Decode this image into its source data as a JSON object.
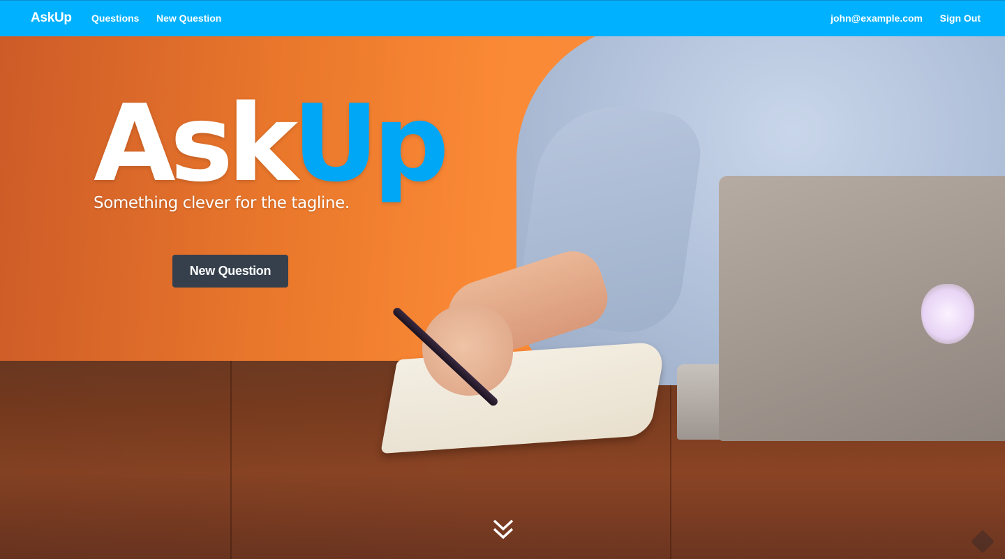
{
  "navbar": {
    "brand": "AskUp",
    "links": {
      "questions": "Questions",
      "new_question": "New Question"
    },
    "user_email": "john@example.com",
    "sign_out": "Sign Out",
    "background_color": "#00b1ff"
  },
  "hero": {
    "title_main": "Ask",
    "title_accent": "Up",
    "accent_color": "#00a7f7",
    "tagline": "Something clever for the tagline.",
    "cta_label": "New Question",
    "cta_color": "#36404d",
    "scroll_icon": "double-chevron-down-icon",
    "background_image": "person-writing-at-desk-with-laptop"
  }
}
